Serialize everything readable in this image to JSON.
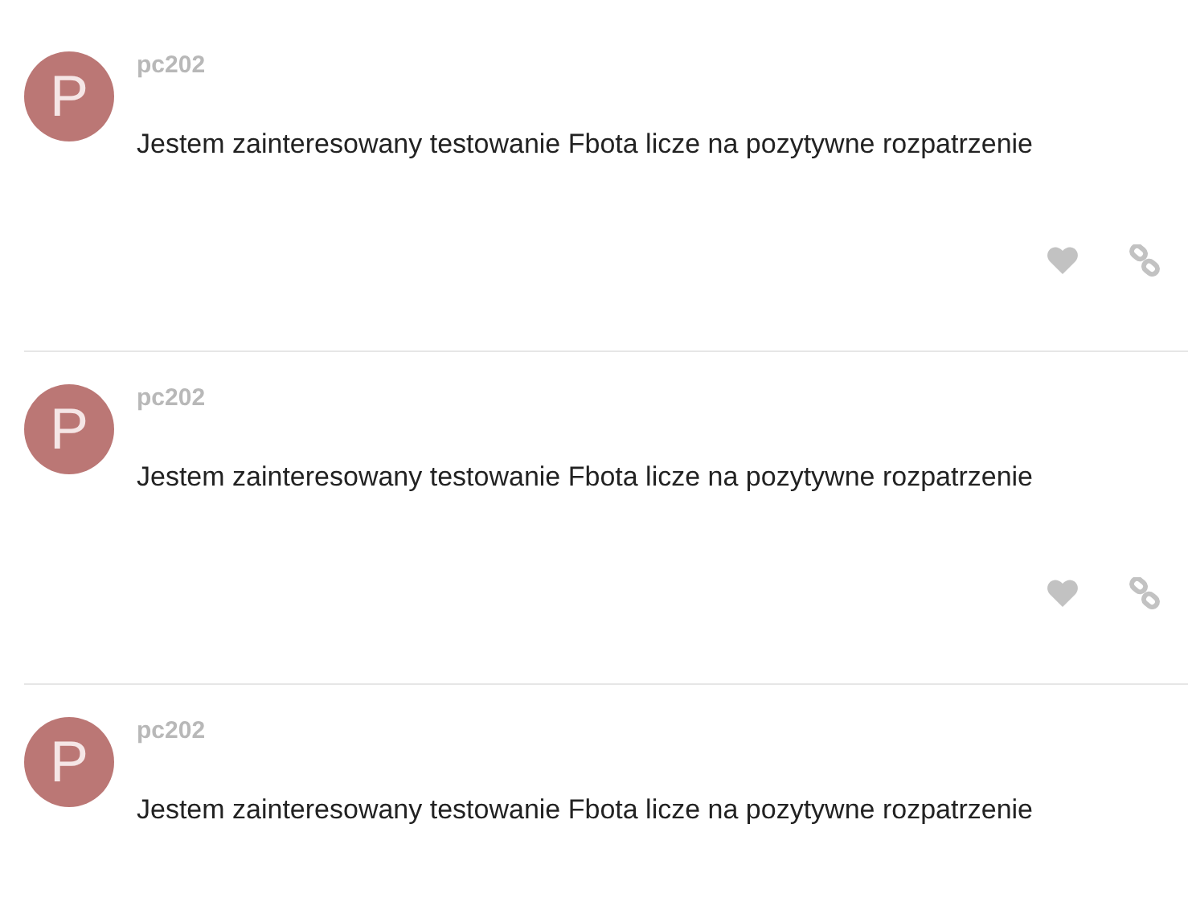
{
  "posts": [
    {
      "username": "pc202",
      "avatar_letter": "P",
      "text": "Jestem zainteresowany testowanie Fbota licze na pozytywne rozpatrzenie"
    },
    {
      "username": "pc202",
      "avatar_letter": "P",
      "text": "Jestem zainteresowany testowanie Fbota licze na pozytywne rozpatrzenie"
    },
    {
      "username": "pc202",
      "avatar_letter": "P",
      "text": "Jestem zainteresowany testowanie Fbota licze na pozytywne rozpatrzenie"
    }
  ]
}
